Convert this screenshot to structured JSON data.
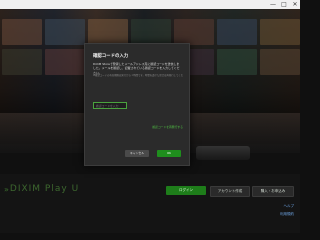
{
  "window": {
    "minimize_glyph": "—",
    "maximize_glyph": "□",
    "close_glyph": "✕"
  },
  "brand": {
    "arrows": "»",
    "name": "DIXIM Play U"
  },
  "bottom_bar": {
    "primary_button": "ログイン",
    "secondary_button_1": "アカウント作成",
    "secondary_button_2": "購入・お申込み",
    "link_1": "ヘルプ",
    "link_2": "利用規約"
  },
  "dialog": {
    "title": "確認コードの入力",
    "description": "DiXiM Storeで登録したメールアドレス宛に確認コードを送信しました。メールを確認し、記載されている確認コードを入力してください。",
    "note": "※確認コードの有効期限は発行から１時間です。時間を過ぎた場合は再発行してください。",
    "input_placeholder": "確認コードを入力",
    "resend_link": "確認コードを再発行する",
    "cancel_button": "キャンセル",
    "ok_button": "OK"
  },
  "colors": {
    "accent_green": "#1f8e1d",
    "link_green": "#4fbf43",
    "link_blue": "#6fa6e6"
  }
}
